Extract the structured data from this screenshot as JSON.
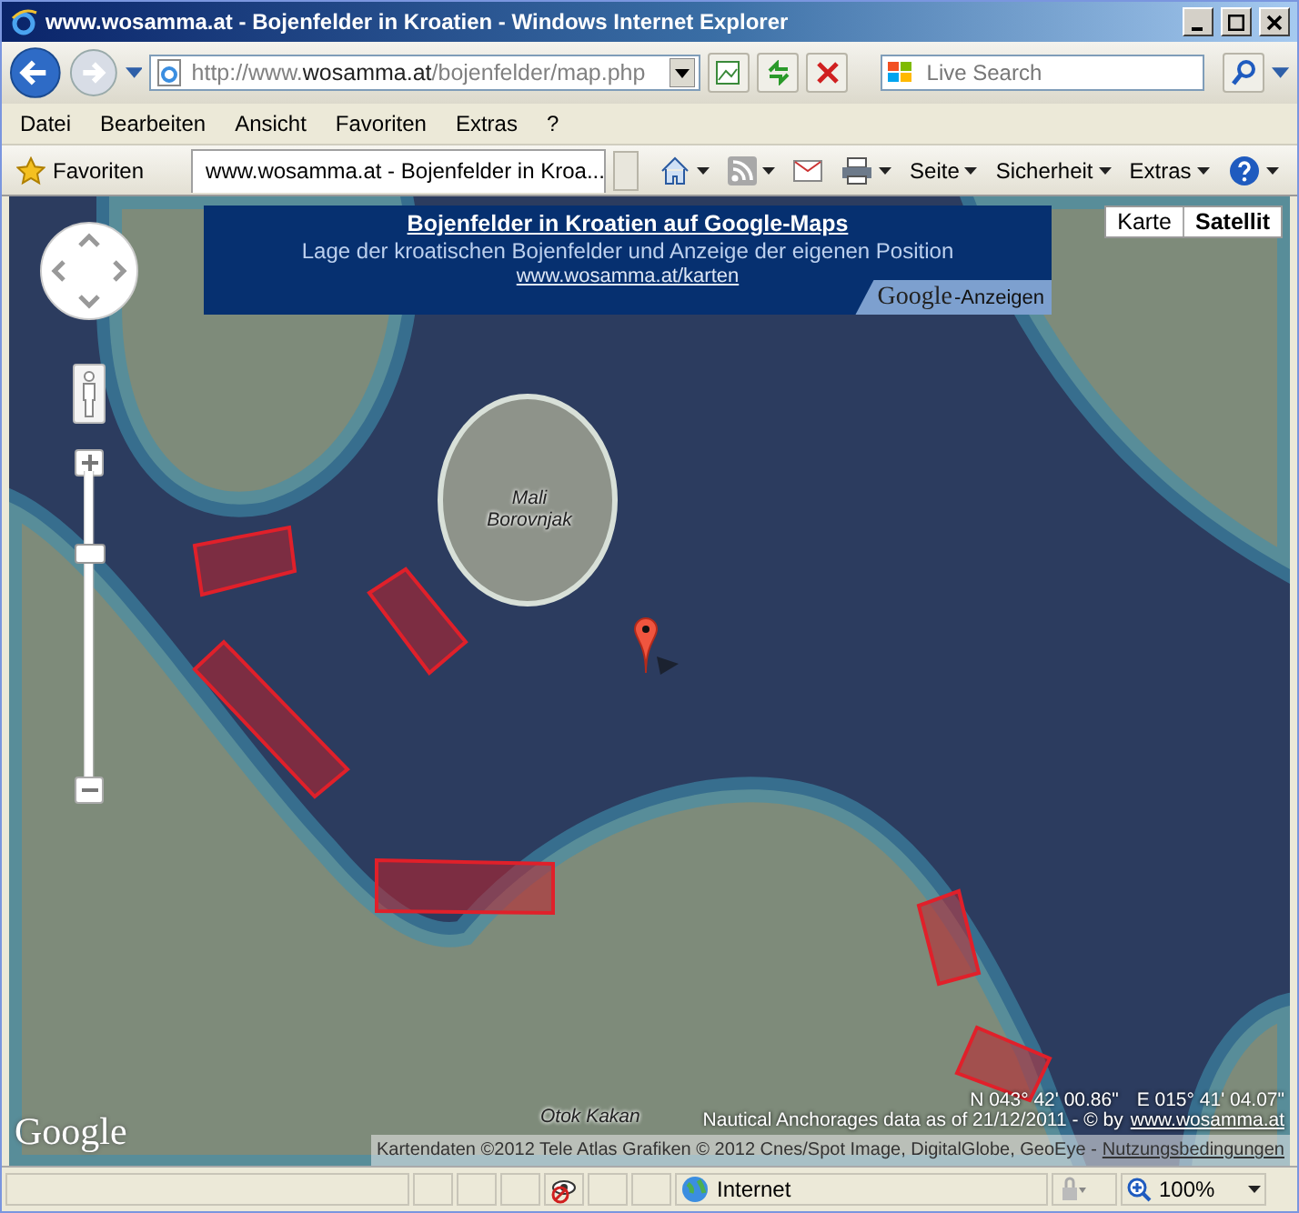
{
  "window": {
    "title": "www.wosamma.at - Bojenfelder in Kroatien - Windows Internet Explorer"
  },
  "address_bar": {
    "url": "http://www.**wosamma.at**/bojenfelder/map.php"
  },
  "search": {
    "placeholder": "Live Search"
  },
  "menu": [
    "Datei",
    "Bearbeiten",
    "Ansicht",
    "Favoriten",
    "Extras",
    "?"
  ],
  "favorites_bar": {
    "favorites": "Favoriten",
    "tab": "www.wosamma.at - Bojenfelder in Kroa...",
    "commands": [
      "Seite",
      "Sicherheit",
      "Extras"
    ]
  },
  "map": {
    "banner": {
      "title": "Bojenfelder in Kroatien auf Google-Maps",
      "subtitle": "Lage der kroatischen Bojenfelder und Anzeige der eigenen Position",
      "link": "www.wosamma.at/karten",
      "ads_logo": "Google",
      "ads_label": "-Anzeigen"
    },
    "map_types": [
      {
        "label": "Karte",
        "selected": false
      },
      {
        "label": "Satellit",
        "selected": true
      }
    ],
    "zoom": {
      "level": 0.75
    },
    "place_labels": [
      "Mali Borovnjak",
      "Otok Kakan"
    ],
    "latitude": "N 043° 42' 00.86\"",
    "longitude": "E 015° 41' 04.07\"",
    "data_note": "Nautical Anchorages data as of 21/12/2011 - © by",
    "data_link": "www.wosamma.at",
    "attribution": "Kartendaten ©2012 Tele Atlas  Grafiken © 2012 Cnes/Spot Image, DigitalGlobe, GeoEye -",
    "terms_link": "Nutzungsbedingungen",
    "logo": "Google"
  },
  "status_bar": {
    "zone": "Internet",
    "zoom": "100%"
  }
}
